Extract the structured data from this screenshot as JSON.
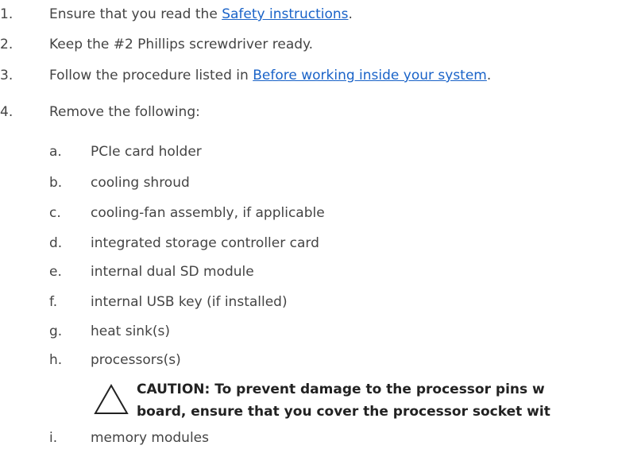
{
  "steps": [
    {
      "num": "1.",
      "text_before": "Ensure that you read the ",
      "link": "Safety instructions",
      "text_after": "."
    },
    {
      "num": "2.",
      "text": "Keep the #2 Phillips screwdriver ready."
    },
    {
      "num": "3.",
      "text_before": "Follow the procedure listed in ",
      "link": "Before working inside your system",
      "text_after": "."
    },
    {
      "num": "4.",
      "text": "Remove the following:"
    }
  ],
  "substeps": [
    {
      "letter": "a.",
      "text": "PCIe card holder"
    },
    {
      "letter": "b.",
      "text": "cooling shroud"
    },
    {
      "letter": "c.",
      "text": "cooling-fan assembly, if applicable"
    },
    {
      "letter": "d.",
      "text": "integrated storage controller card"
    },
    {
      "letter": "e.",
      "text": "internal dual SD module"
    },
    {
      "letter": "f.",
      "text": "internal USB key (if installed)"
    },
    {
      "letter": "g.",
      "text": "heat sink(s)"
    },
    {
      "letter": "h.",
      "text": "processors(s)"
    },
    {
      "letter": "i.",
      "text": "memory modules"
    }
  ],
  "caution": {
    "icon": "caution-triangle-icon",
    "line1": "CAUTION: To prevent damage to the processor pins w",
    "line2": "board, ensure that you cover the processor socket wit"
  },
  "colors": {
    "text": "#444444",
    "link": "#1a63c8"
  }
}
